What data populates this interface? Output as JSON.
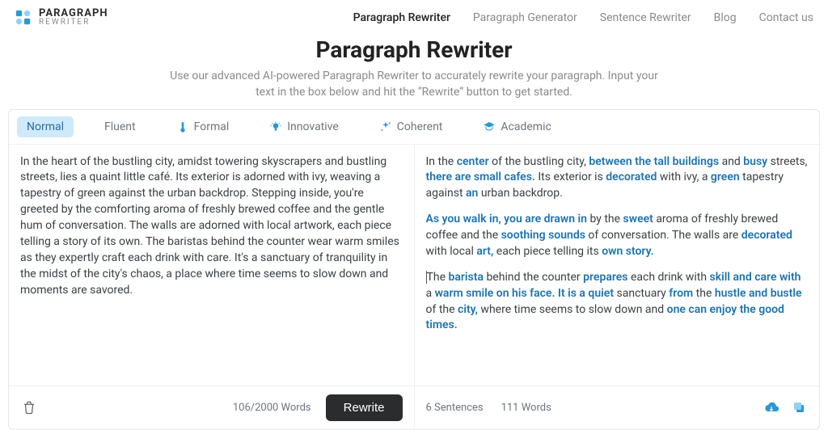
{
  "logo": {
    "main": "PARAGRAPH",
    "sub": "REWRITER"
  },
  "nav": {
    "items": [
      {
        "label": "Paragraph Rewriter",
        "active": true
      },
      {
        "label": "Paragraph Generator",
        "active": false
      },
      {
        "label": "Sentence Rewriter",
        "active": false
      },
      {
        "label": "Blog",
        "active": false
      },
      {
        "label": "Contact us",
        "active": false
      }
    ]
  },
  "hero": {
    "title": "Paragraph Rewriter",
    "subtitle": "Use our advanced AI-powered Paragraph Rewriter to accurately rewrite your paragraph. Input your text in the box below and hit the “Rewrite” button to get started."
  },
  "tabs": [
    {
      "label": "Normal",
      "icon": null,
      "active": true
    },
    {
      "label": "Fluent",
      "icon": null,
      "active": false
    },
    {
      "label": "Formal",
      "icon": "thermometer",
      "active": false
    },
    {
      "label": "Innovative",
      "icon": "bulb",
      "active": false
    },
    {
      "label": "Coherent",
      "icon": "sparkle",
      "active": false
    },
    {
      "label": "Academic",
      "icon": "graduation",
      "active": false
    }
  ],
  "input": {
    "text": "In the heart of the bustling city, amidst towering skyscrapers and bustling streets, lies a quaint little café. Its exterior is adorned with ivy, weaving a tapestry of green against the urban backdrop. Stepping inside, you're greeted by the comforting aroma of freshly brewed coffee and the gentle hum of conversation. The walls are adorned with local artwork, each piece telling a story of its own. The baristas behind the counter wear warm smiles as they expertly craft each drink with care. It's a sanctuary of tranquility in the midst of the city's chaos, a place where time seems to slow down and moments are savored.",
    "counter": "106/2000 Words",
    "rewrite_label": "Rewrite"
  },
  "output": {
    "p1": [
      {
        "t": "In the "
      },
      {
        "t": "center",
        "h": 1
      },
      {
        "t": " of the bustling city, "
      },
      {
        "t": "between the tall buildings",
        "h": 1
      },
      {
        "t": " and "
      },
      {
        "t": "busy",
        "h": 1
      },
      {
        "t": " streets, "
      },
      {
        "t": "there are small cafes.",
        "h": 1
      },
      {
        "t": " Its exterior is "
      },
      {
        "t": "decorated",
        "h": 1
      },
      {
        "t": " with ivy, a "
      },
      {
        "t": "green",
        "h": 1
      },
      {
        "t": " tapestry against "
      },
      {
        "t": "an",
        "h": 1
      },
      {
        "t": " urban backdrop."
      }
    ],
    "p2": [
      {
        "t": "As you walk in, you are drawn in",
        "h": 1
      },
      {
        "t": " by the "
      },
      {
        "t": "sweet",
        "h": 1
      },
      {
        "t": " aroma of freshly brewed coffee and the "
      },
      {
        "t": "soothing sounds",
        "h": 1
      },
      {
        "t": " of conversation. The walls are "
      },
      {
        "t": "decorated",
        "h": 1
      },
      {
        "t": " with local "
      },
      {
        "t": "art,",
        "h": 1
      },
      {
        "t": " each piece telling its "
      },
      {
        "t": "own story.",
        "h": 1
      }
    ],
    "p3": [
      {
        "t": "The "
      },
      {
        "t": "barista",
        "h": 1
      },
      {
        "t": " behind the counter "
      },
      {
        "t": "prepares",
        "h": 1
      },
      {
        "t": " each drink with "
      },
      {
        "t": "skill and care with",
        "h": 1
      },
      {
        "t": " a "
      },
      {
        "t": "warm smile on his face. It is a quiet",
        "h": 1
      },
      {
        "t": " sanctuary "
      },
      {
        "t": "from",
        "h": 1
      },
      {
        "t": " the "
      },
      {
        "t": "hustle and bustle",
        "h": 1
      },
      {
        "t": " of the "
      },
      {
        "t": "city,",
        "h": 1
      },
      {
        "t": " where time seems to slow down and "
      },
      {
        "t": "one can enjoy the good times.",
        "h": 1
      }
    ],
    "sentences_label": "6 Sentences",
    "words_label": "111 Words"
  }
}
